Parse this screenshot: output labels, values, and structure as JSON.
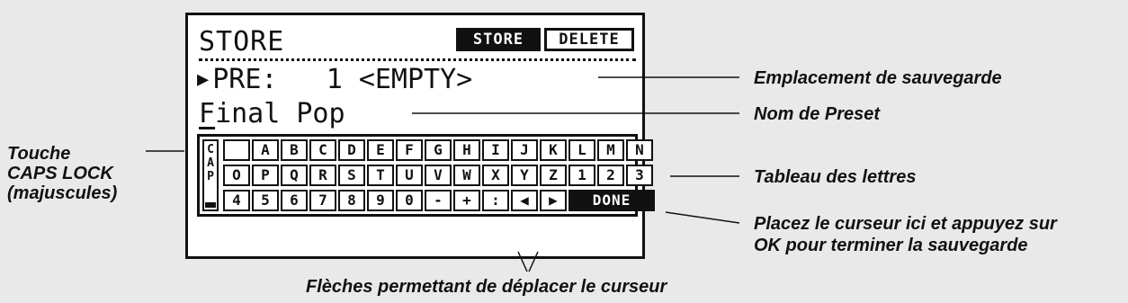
{
  "lcd": {
    "title": "STORE",
    "store_button": "STORE",
    "delete_button": "DELETE",
    "pre_arrow": "▶",
    "pre_label": "PRE:",
    "pre_number": "1",
    "pre_status": "<EMPTY>",
    "name_first": "F",
    "name_rest": "inal Pop",
    "caps_key": "CAP",
    "keyboard": {
      "row1": [
        " ",
        "A",
        "B",
        "C",
        "D",
        "E",
        "F",
        "G",
        "H",
        "I",
        "J",
        "K",
        "L",
        "M",
        "N"
      ],
      "row2": [
        "O",
        "P",
        "Q",
        "R",
        "S",
        "T",
        "U",
        "V",
        "W",
        "X",
        "Y",
        "Z",
        "1",
        "2",
        "3"
      ],
      "row3": [
        "4",
        "5",
        "6",
        "7",
        "8",
        "9",
        "0",
        "-",
        "+",
        ":",
        "◀",
        "▶"
      ],
      "done": "DONE"
    }
  },
  "annotations": {
    "location": "Emplacement de sauvegarde",
    "preset_name": "Nom de Preset",
    "letters_table": "Tableau des lettres",
    "caps_line1": "Touche",
    "caps_line2": "CAPS LOCK",
    "caps_line3": "(majuscules)",
    "done_line1": "Placez le curseur ici et appuyez sur",
    "done_line2": "OK pour terminer la sauvegarde",
    "arrows": "Flèches permettant de déplacer le curseur"
  }
}
